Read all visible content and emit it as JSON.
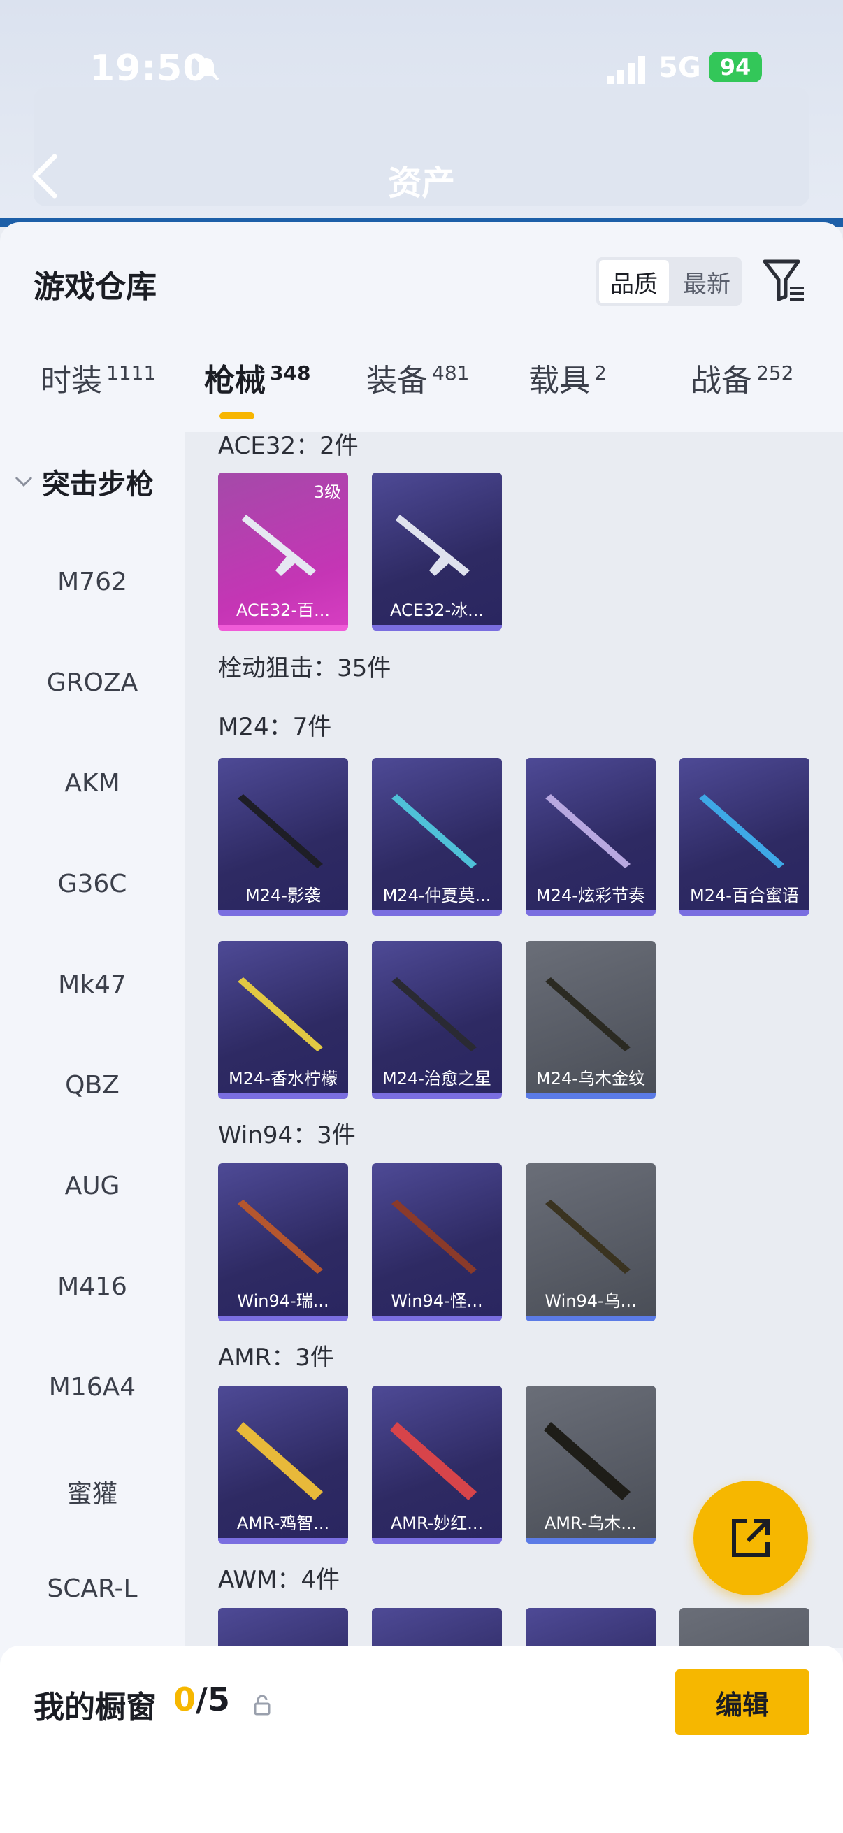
{
  "status": {
    "time": "19:50",
    "network": "5G",
    "battery": "94"
  },
  "header": {
    "title": "资产"
  },
  "sheet": {
    "title": "游戏仓库",
    "sort_options": [
      "品质",
      "最新"
    ],
    "tabs": [
      {
        "label": "时装",
        "count": "1111"
      },
      {
        "label": "枪械",
        "count": "348"
      },
      {
        "label": "装备",
        "count": "481"
      },
      {
        "label": "载具",
        "count": "2"
      },
      {
        "label": "战备",
        "count": "252"
      }
    ]
  },
  "sidebar": {
    "group": "突击步枪",
    "items": [
      "M762",
      "GROZA",
      "AKM",
      "G36C",
      "Mk47",
      "QBZ",
      "AUG",
      "M416",
      "M16A4",
      "蜜獾",
      "SCAR-L"
    ]
  },
  "sections": {
    "ace32": "ACE32：2件",
    "sniper": "栓动狙击：35件",
    "m24": "M24：7件",
    "win94": "Win94：3件",
    "amr": "AMR：3件",
    "awm": "AWM：4件"
  },
  "cards": {
    "ace32": [
      {
        "name": "ACE32-百...",
        "level": "3级"
      },
      {
        "name": "ACE32-冰..."
      }
    ],
    "m24": [
      {
        "name": "M24-影袭"
      },
      {
        "name": "M24-仲夏莫..."
      },
      {
        "name": "M24-炫彩节奏"
      },
      {
        "name": "M24-百合蜜语"
      },
      {
        "name": "M24-香水柠檬"
      },
      {
        "name": "M24-治愈之星"
      },
      {
        "name": "M24-乌木金纹"
      }
    ],
    "win94": [
      {
        "name": "Win94-瑞..."
      },
      {
        "name": "Win94-怪..."
      },
      {
        "name": "Win94-乌..."
      }
    ],
    "amr": [
      {
        "name": "AMR-鸡智..."
      },
      {
        "name": "AMR-妙红..."
      },
      {
        "name": "AMR-乌木..."
      }
    ]
  },
  "showcase": {
    "label": "我的橱窗",
    "used": "0",
    "total": "/5",
    "edit_label": "编辑"
  },
  "colors": {
    "accent": "#f6b700",
    "tab_underline": "#f7b500"
  }
}
